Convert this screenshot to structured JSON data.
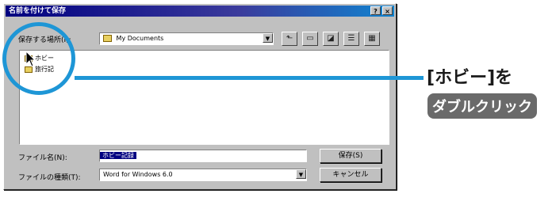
{
  "dialog": {
    "title": "名前を付けて保存",
    "title_buttons": [
      "?",
      "×"
    ],
    "save_in_label": "保存する場所(I):",
    "save_in_value": "My Documents",
    "toolbar": [
      {
        "icon": "up-folder-icon",
        "glyph": "⬑"
      },
      {
        "icon": "desktop-icon",
        "glyph": "▭"
      },
      {
        "icon": "new-folder-icon",
        "glyph": "◪"
      },
      {
        "icon": "list-view-icon",
        "glyph": "☰"
      },
      {
        "icon": "details-view-icon",
        "glyph": "▦"
      }
    ],
    "files": [
      {
        "name": "ホビー"
      },
      {
        "name": "旅行記"
      }
    ],
    "filename_label": "ファイル名(N):",
    "filename_value": "ホビー記録",
    "filetype_label": "ファイルの種類(T):",
    "filetype_value": "Word for Windows 6.0",
    "save_button": "保存(S)",
    "cancel_button": "キャンセル"
  },
  "callout": {
    "line1_open": "[",
    "line1_word": "ホビー",
    "line1_close": "]",
    "line1_suffix": "を",
    "line2": "ダブルクリック"
  },
  "colors": {
    "accent": "#1e96d6",
    "badge": "#6a6a6a"
  }
}
